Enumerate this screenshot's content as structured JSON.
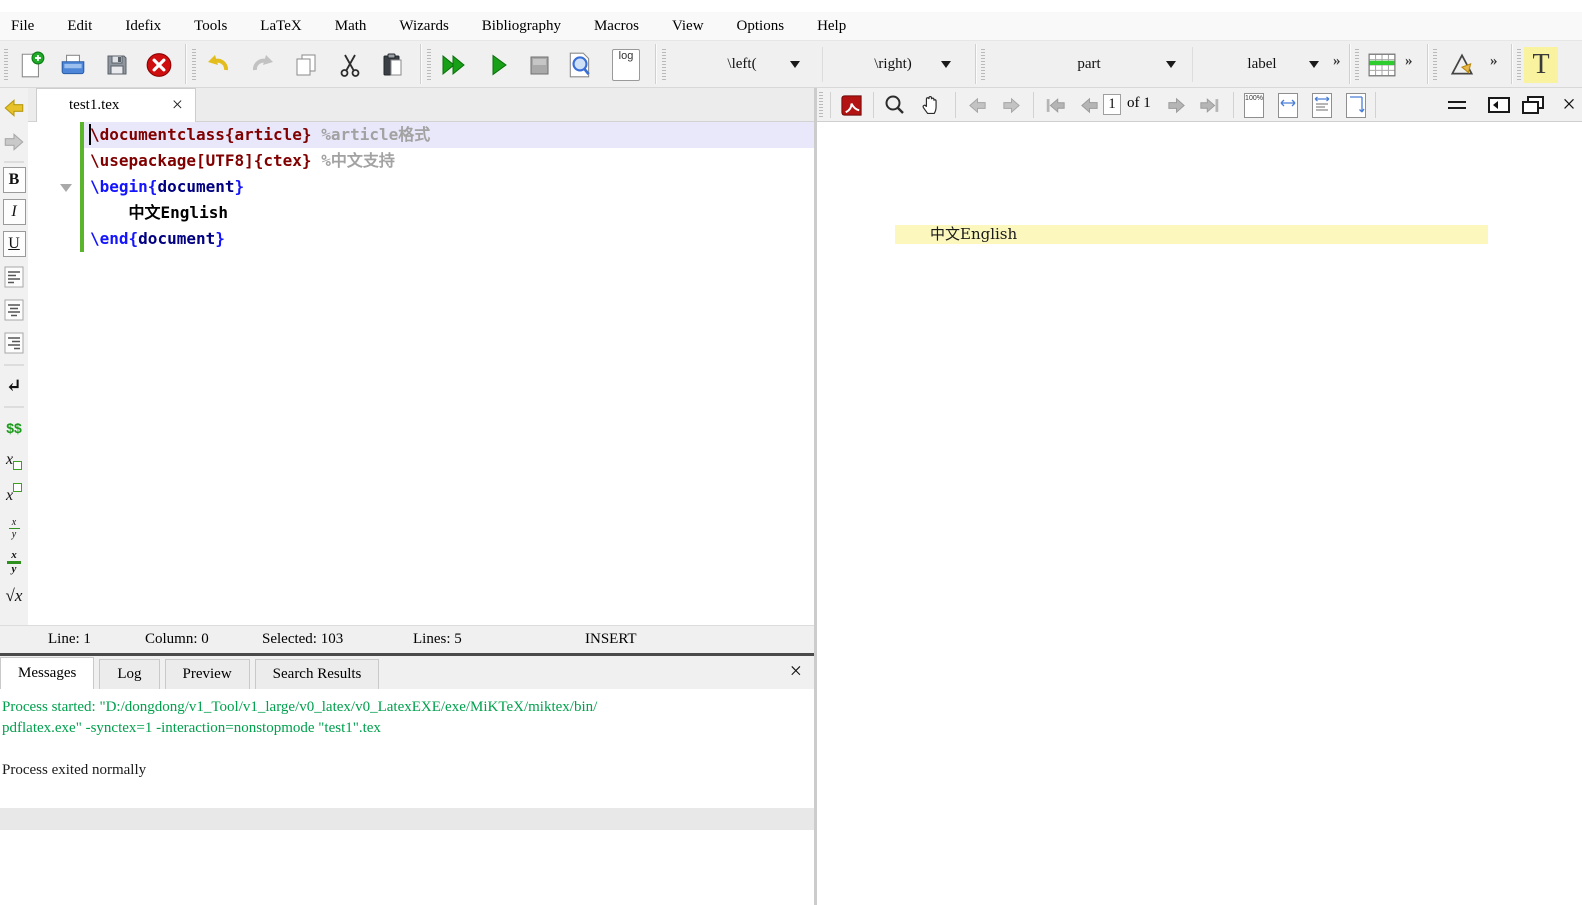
{
  "menubar": {
    "items": [
      "File",
      "Edit",
      "Idefix",
      "Tools",
      "LaTeX",
      "Math",
      "Wizards",
      "Bibliography",
      "Macros",
      "View",
      "Options",
      "Help"
    ]
  },
  "toolbar": {
    "delimiter_left": "\\left(",
    "delimiter_right": "\\right)",
    "sectioning": "part",
    "reference": "label",
    "overflow_chevron": "»",
    "log_badge": "log",
    "text_style_badge": "T"
  },
  "format_toolbar": {
    "bold": "B",
    "italic": "I",
    "underline": "U",
    "newline": "↵",
    "math_inline": "$$",
    "var": "x",
    "frac_num": "x",
    "frac_den": "y",
    "sqrt": "√x"
  },
  "tabs": {
    "active": "test1.tex",
    "close_glyph": "×"
  },
  "editor": {
    "lines": [
      {
        "current": true,
        "tokens": [
          {
            "text": "\\documentclass{article}",
            "style": "cmd"
          },
          {
            "text": " ",
            "style": "plain"
          },
          {
            "text": "%article格式",
            "style": "comment"
          }
        ]
      },
      {
        "tokens": [
          {
            "text": "\\usepackage[UTF8]{ctex}",
            "style": "cmd"
          },
          {
            "text": " ",
            "style": "plain"
          },
          {
            "text": "%中文支持",
            "style": "comment"
          }
        ]
      },
      {
        "tokens": [
          {
            "text": "\\begin{",
            "style": "kw"
          },
          {
            "text": "document",
            "style": "env"
          },
          {
            "text": "}",
            "style": "kw"
          }
        ]
      },
      {
        "tokens": [
          {
            "text": "    ",
            "style": "plain"
          },
          {
            "text": "中文English",
            "style": "doctext"
          }
        ]
      },
      {
        "tokens": [
          {
            "text": "\\end{",
            "style": "kw"
          },
          {
            "text": "document",
            "style": "env"
          },
          {
            "text": "}",
            "style": "kw"
          }
        ]
      }
    ]
  },
  "statusbar": {
    "line": "Line: 1",
    "column": "Column: 0",
    "selected": "Selected: 103",
    "lines": "Lines: 5",
    "mode": "INSERT"
  },
  "messages": {
    "tabs": [
      "Messages",
      "Log",
      "Preview",
      "Search Results"
    ],
    "active_tab": "Messages",
    "close_glyph": "×",
    "lines": [
      {
        "text": "Process started: \"D:/dongdong/v1_Tool/v1_large/v0_latex/v0_LatexEXE/exe/MiKTeX/miktex/bin/",
        "kind": "info"
      },
      {
        "text": "pdflatex.exe\" -synctex=1 -interaction=nonstopmode \"test1\".tex",
        "kind": "info"
      },
      {
        "text": "",
        "kind": "plain"
      },
      {
        "text": "Process exited normally",
        "kind": "plain"
      }
    ]
  },
  "pdf_viewer": {
    "page": "1",
    "page_count": "of 1",
    "zoom_badge": "100%",
    "close_glyph": "×",
    "document": {
      "text": "中文English",
      "highlight_color": "#fbf7bd"
    }
  },
  "colors": {
    "accent_change_bar": "#5ab52d",
    "message_green": "#00a04d",
    "syntax_command": "#800000",
    "syntax_keyword": "#1414ff",
    "syntax_environment": "#000080",
    "syntax_comment": "#a2a2a2",
    "current_line": "#e9e8fb",
    "pdf_highlight": "#fbf7bd"
  }
}
